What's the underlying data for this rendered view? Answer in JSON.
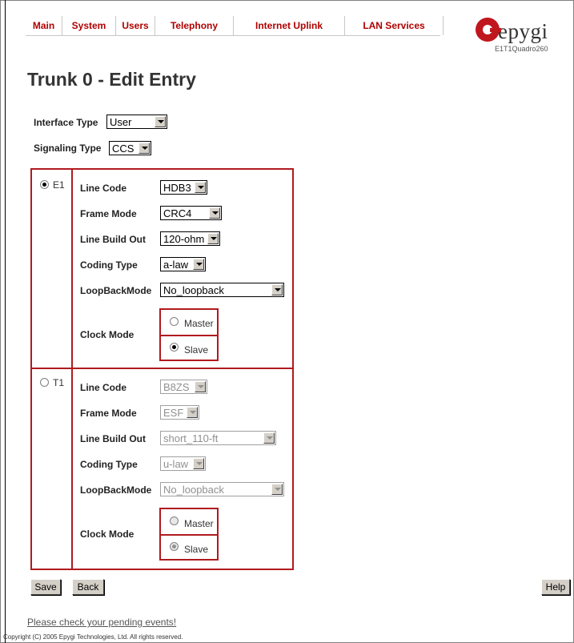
{
  "nav": {
    "tabs": [
      {
        "label": "Main"
      },
      {
        "label": "System"
      },
      {
        "label": "Users"
      },
      {
        "label": "Telephony"
      },
      {
        "label": "Internet Uplink"
      },
      {
        "label": "LAN Services"
      }
    ]
  },
  "brand": {
    "name": "epygi",
    "model": "E1T1Quadro260",
    "color": "#c0161d"
  },
  "page_title": "Trunk 0 - Edit Entry",
  "form": {
    "interface_type": {
      "label": "Interface Type",
      "value": "User"
    },
    "signaling_type": {
      "label": "Signaling Type",
      "value": "CCS"
    }
  },
  "e1": {
    "radio_label": "E1",
    "selected": true,
    "line_code": {
      "label": "Line Code",
      "value": "HDB3"
    },
    "frame_mode": {
      "label": "Frame Mode",
      "value": "CRC4"
    },
    "line_build_out": {
      "label": "Line Build Out",
      "value": "120-ohm"
    },
    "coding_type": {
      "label": "Coding Type",
      "value": "a-law"
    },
    "loopback_mode": {
      "label": "LoopBackMode",
      "value": "No_loopback"
    },
    "clock_mode": {
      "label": "Clock Mode",
      "master": "Master",
      "slave": "Slave",
      "selected": "Slave"
    }
  },
  "t1": {
    "radio_label": "T1",
    "selected": false,
    "line_code": {
      "label": "Line Code",
      "value": "B8ZS"
    },
    "frame_mode": {
      "label": "Frame Mode",
      "value": "ESF"
    },
    "line_build_out": {
      "label": "Line Build Out",
      "value": "short_110-ft"
    },
    "coding_type": {
      "label": "Coding Type",
      "value": "u-law"
    },
    "loopback_mode": {
      "label": "LoopBackMode",
      "value": "No_loopback"
    },
    "clock_mode": {
      "label": "Clock Mode",
      "master": "Master",
      "slave": "Slave",
      "selected": "Slave"
    }
  },
  "buttons": {
    "save": "Save",
    "back": "Back",
    "help": "Help"
  },
  "footer": {
    "pending_link": "Please check your pending events!",
    "copyright": "Copyright (C) 2005 Epygi Technologies, Ltd. All rights reserved."
  }
}
